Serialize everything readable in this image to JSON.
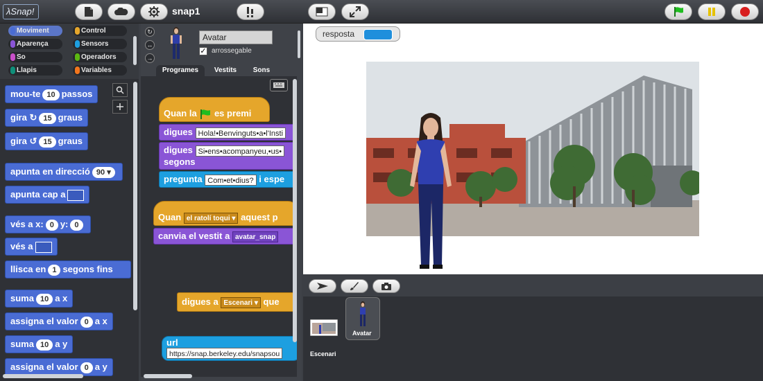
{
  "topbar": {
    "logo_text": "λSnap!",
    "project_name": "snap1"
  },
  "palette": {
    "categories": [
      "Moviment",
      "Control",
      "Aparença",
      "Sensors",
      "So",
      "Operadors",
      "Llapis",
      "Variables"
    ],
    "active_category": "Moviment",
    "colors": {
      "Moviment": "#4a6cd4",
      "Control": "#e5a62b",
      "Aparença": "#8a55d6",
      "Sensors": "#1d9fe0",
      "So": "#c94fc9",
      "Operadors": "#5cb712",
      "Llapis": "#0f8f7a",
      "Variables": "#f3761d"
    },
    "blocks": {
      "move": {
        "prefix": "mou-te",
        "value": "10",
        "suffix": "passos"
      },
      "turn_cw": {
        "prefix": "gira",
        "value": "15",
        "suffix": "graus"
      },
      "turn_ccw": {
        "prefix": "gira",
        "value": "15",
        "suffix": "graus"
      },
      "point_dir": {
        "prefix": "apunta en direcció",
        "value": "90"
      },
      "point_towards": {
        "prefix": "apunta cap a"
      },
      "goto_xy": {
        "prefix": "vés a x:",
        "x": "0",
        "mid": "y:",
        "y": "0"
      },
      "goto": {
        "prefix": "vés a"
      },
      "glide": {
        "prefix": "llisca en",
        "value": "1",
        "suffix": "segons fins"
      },
      "change_x": {
        "prefix": "suma",
        "value": "10",
        "suffix": "a x"
      },
      "set_x": {
        "prefix": "assigna el valor",
        "value": "0",
        "suffix": "a x"
      },
      "change_y": {
        "prefix": "suma",
        "value": "10",
        "suffix": "a y"
      },
      "set_y": {
        "prefix": "assigna el valor",
        "value": "0",
        "suffix": "a y"
      }
    }
  },
  "sprite": {
    "name": "Avatar",
    "draggable_label": "arrossegable",
    "draggable_checked": "✓",
    "tabs": [
      "Programes",
      "Vestits",
      "Sons"
    ],
    "active_tab": "Programes"
  },
  "scripts": {
    "s1_hat": {
      "prefix": "Quan la",
      "suffix": "es premi"
    },
    "s1_say": {
      "label": "digues",
      "text": "Hola!•Benvinguts•a•l'Insti"
    },
    "s1_saysecs": {
      "label": "digues",
      "text": "Si•ens•acompanyeu,•us•",
      "label2": "segons"
    },
    "s1_ask": {
      "label": "pregunta",
      "text": "Com•et•dius?",
      "suffix": "i espe"
    },
    "s2_hat": {
      "prefix": "Quan",
      "dropdown": "el ratolí toqui",
      "suffix": "aquest p"
    },
    "s2_costume": {
      "label": "canvia el vestit a",
      "dropdown": "avatar_snap"
    },
    "s3_say": {
      "label": "digues a",
      "dropdown": "Escenari",
      "suffix": "que"
    },
    "url": {
      "label": "url",
      "text": "https://snap.berkeley.edu/snapsou"
    }
  },
  "stage": {
    "watcher": {
      "label": "resposta",
      "value": ""
    }
  },
  "corral": {
    "stage_label": "Escenari",
    "sprite_label": "Avatar"
  }
}
